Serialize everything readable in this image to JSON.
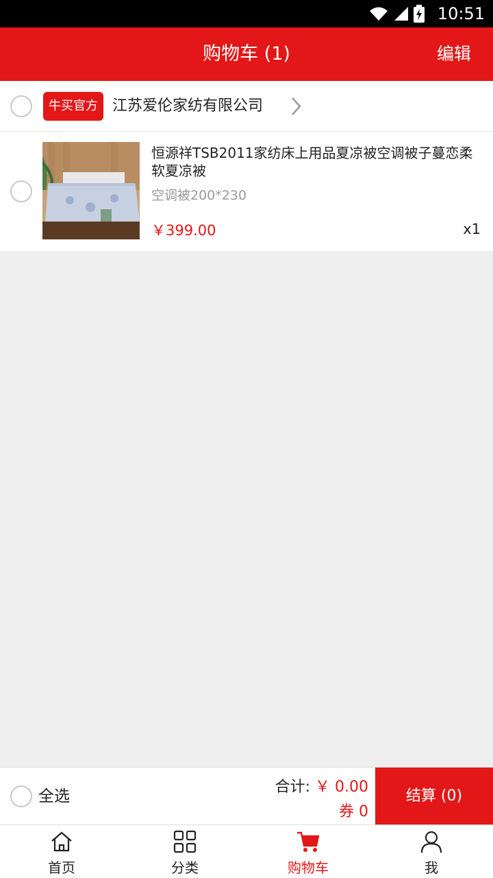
{
  "status_bar": {
    "time": "10:51"
  },
  "header": {
    "title": "购物车 (1)",
    "edit_label": "编辑"
  },
  "shop": {
    "tag": "牛买官方",
    "name": "江苏爱伦家纺有限公司"
  },
  "cart_item": {
    "title": "恒源祥TSB2011家纺床上用品夏凉被空调被子蔓恋柔软夏凉被",
    "spec": "空调被200*230",
    "price": "￥399.00",
    "quantity": "x1"
  },
  "summary": {
    "select_all_label": "全选",
    "total_label": "合计:",
    "total_amount": "￥ 0.00",
    "coupon_label": "券",
    "coupon_value": "0",
    "checkout_label": "结算 (0)"
  },
  "tabbar": {
    "items": [
      {
        "label": "首页",
        "icon": "home-icon"
      },
      {
        "label": "分类",
        "icon": "category-grid-icon"
      },
      {
        "label": "购物车",
        "icon": "cart-icon",
        "active": true
      },
      {
        "label": "我",
        "icon": "profile-icon"
      }
    ]
  },
  "colors": {
    "accent": "#e31717",
    "background": "#efefef"
  }
}
